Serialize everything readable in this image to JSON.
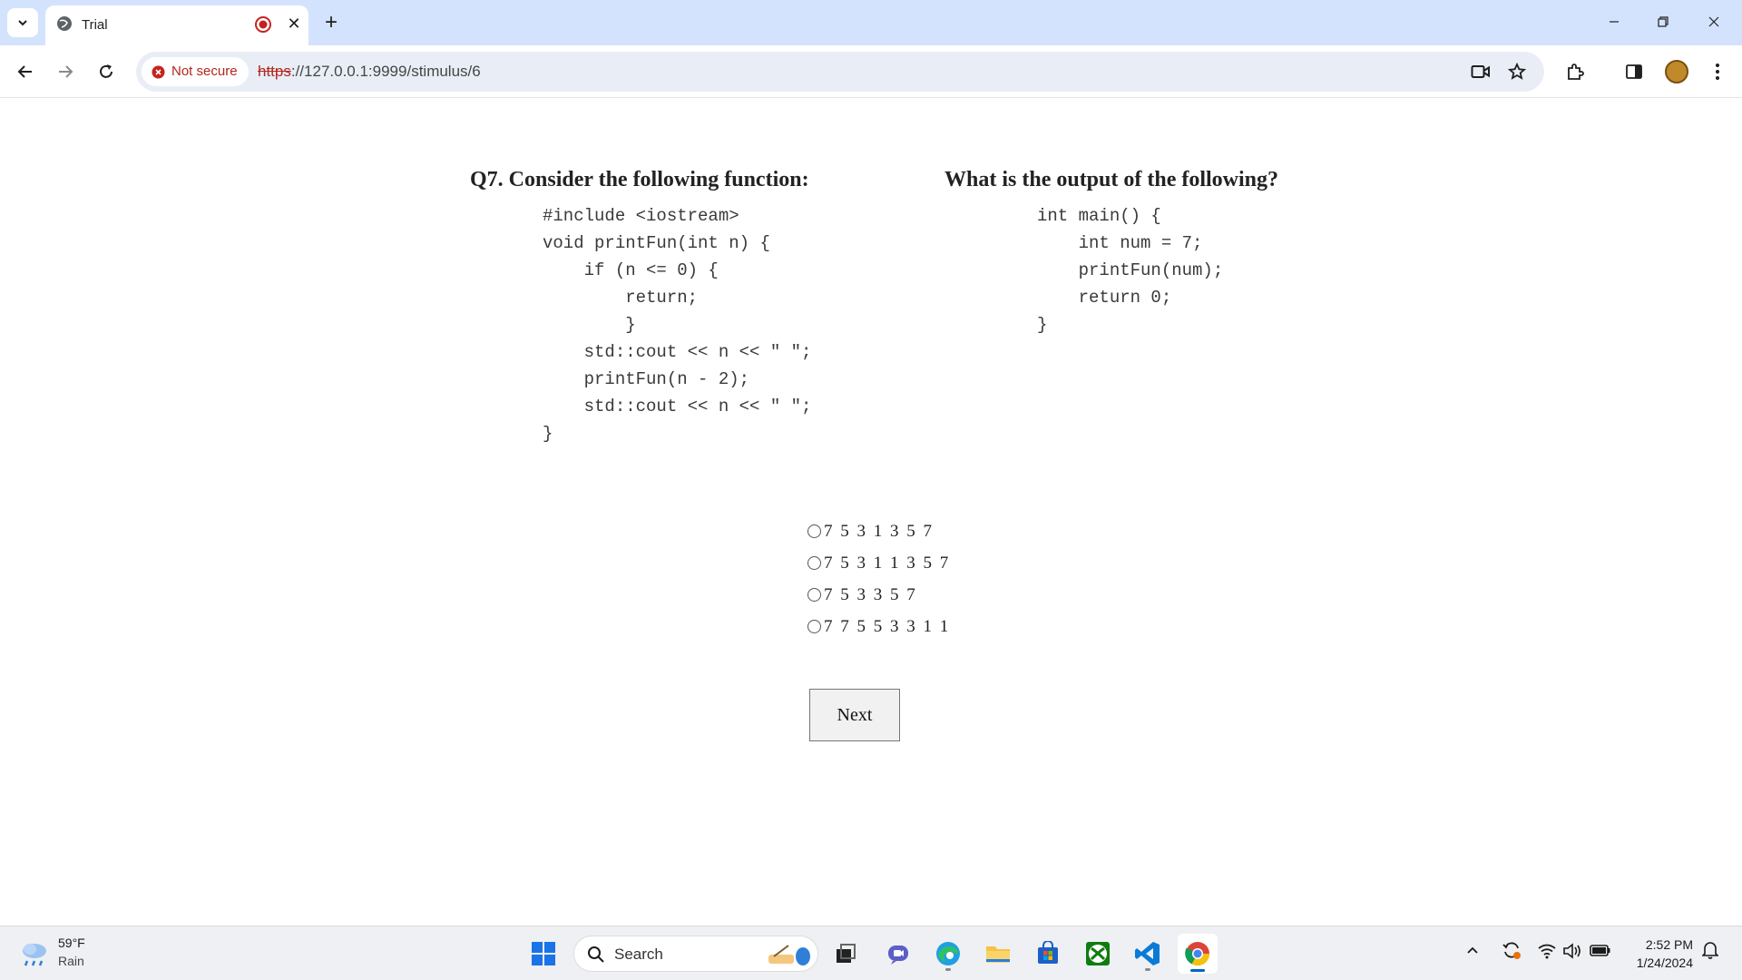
{
  "browser": {
    "tab_title": "Trial",
    "security_label": "Not secure",
    "url_scheme": "https",
    "url_rest": "://127.0.0.1:9999/stimulus/6"
  },
  "question": {
    "heading_left": "Q7. Consider the following function:",
    "heading_right": "What is the output of the following?",
    "code_left": [
      "#include <iostream>",
      "void printFun(int n) {",
      "    if (n <= 0) {",
      "        return;",
      "        }",
      "    std::cout << n << \" \";",
      "    printFun(n - 2);",
      "    std::cout << n << \" \";",
      "}"
    ],
    "code_right": [
      "int main() {",
      "    int num = 7;",
      "    printFun(num);",
      "    return 0;",
      "}"
    ],
    "options": [
      "7 5 3 1 3 5 7",
      "7 5 3 1 1 3 5 7",
      "7 5 3 3 5 7",
      "7 7 5 5 3 3 1 1"
    ],
    "next_label": "Next"
  },
  "taskbar": {
    "weather_temp": "59°F",
    "weather_desc": "Rain",
    "search_placeholder": "Search",
    "time": "2:52 PM",
    "date": "1/24/2024"
  },
  "colors": {
    "tabstrip": "#d3e3fd",
    "omnibox": "#e9eef6",
    "insecure": "#b3261e",
    "accent": "#0067c0"
  }
}
